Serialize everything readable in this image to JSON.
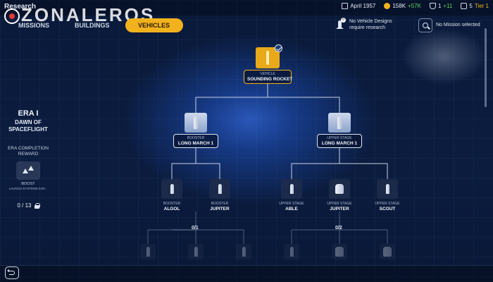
{
  "header": {
    "title": "Research",
    "watermark": "ZONALEROS",
    "tabs": [
      {
        "label": "MISSIONS"
      },
      {
        "label": "BUILDINGS"
      },
      {
        "label": "VEHICLES",
        "active": true
      }
    ],
    "stats": {
      "date": "April 1957",
      "money": "158K",
      "money_delta": "+57K",
      "science": "1",
      "science_delta": "+11",
      "reputation": "5",
      "tier": "Tier 1"
    },
    "notice": {
      "badge": "0",
      "line1": "No Vehicle Designs",
      "line2": "require research"
    },
    "mission": "No Mission selected"
  },
  "era": {
    "title": "ERA I",
    "subtitle_line1": "DAWN OF",
    "subtitle_line2": "SPACEFLIGHT",
    "reward_label_line1": "ERA COMPLETION",
    "reward_label_line2": "REWARD",
    "reward_name": "BOOST",
    "reward_desc": "LAUNCH SYSTEMS EXP...",
    "progress": "0 / 13"
  },
  "tree": {
    "root": {
      "category": "VEHICLE",
      "name": "SOUNDING ROCKET",
      "researched": true
    },
    "level1": [
      {
        "category": "BOOSTER",
        "name": "LONG MARCH 1"
      },
      {
        "category": "UPPER STAGE",
        "name": "LONG MARCH 1"
      }
    ],
    "level2_left": [
      {
        "category": "BOOSTER",
        "name": "ALGOL"
      },
      {
        "category": "BOOSTER",
        "name": "JUPITER"
      }
    ],
    "level2_right": [
      {
        "category": "UPPER STAGE",
        "name": "ABLE"
      },
      {
        "category": "UPPER STAGE",
        "name": "JUPITER"
      },
      {
        "category": "UPPER STAGE",
        "name": "SCOUT"
      }
    ],
    "count_left": "0/1",
    "count_right": "0/2"
  },
  "colors": {
    "accent": "#f2b21d",
    "background": "#0b1c3f",
    "positive": "#5fd35f"
  }
}
